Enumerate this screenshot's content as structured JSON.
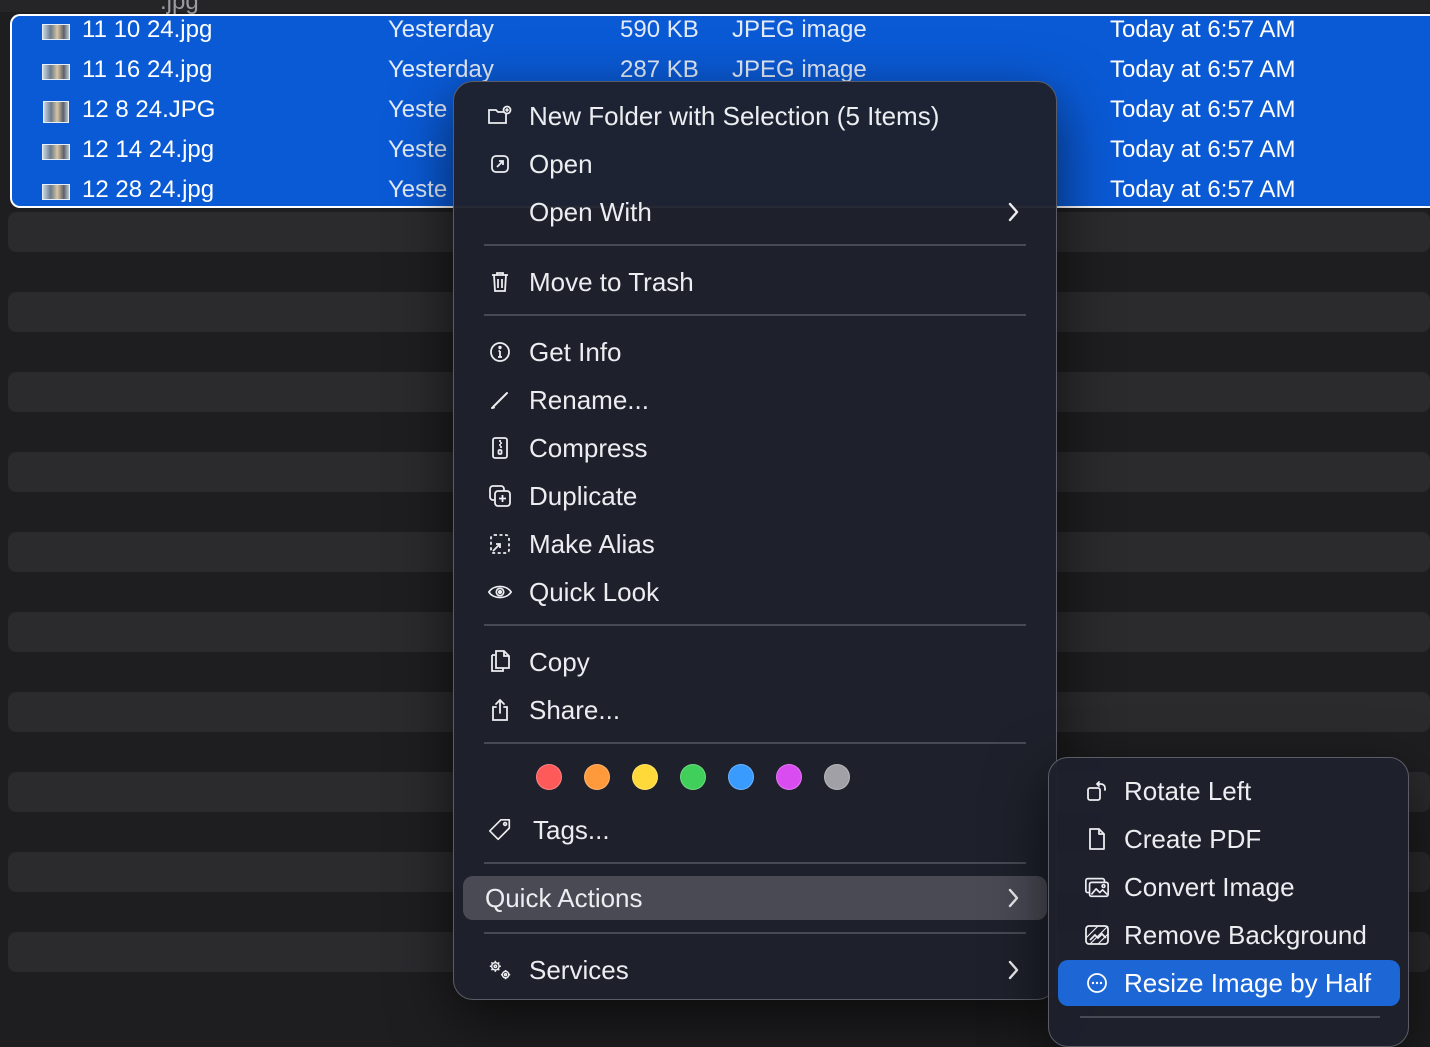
{
  "top_fragment": ".jpg",
  "files": [
    {
      "name": "11 10 24.jpg",
      "date_modified": "Yesterday",
      "size": "590 KB",
      "kind": "JPEG image",
      "date_added": "Today at 6:57 AM"
    },
    {
      "name": "11 16 24.jpg",
      "date_modified": "Yesterday",
      "size": "287 KB",
      "kind": "JPEG image",
      "date_added": "Today at 6:57 AM"
    },
    {
      "name": "12 8 24.JPG",
      "date_modified": "Yeste",
      "size": "",
      "kind": "",
      "date_added": "Today at 6:57 AM"
    },
    {
      "name": "12 14 24.jpg",
      "date_modified": "Yeste",
      "size": "",
      "kind": "",
      "date_added": "Today at 6:57 AM"
    },
    {
      "name": "12 28 24.jpg",
      "date_modified": "Yeste",
      "size": "",
      "kind": "",
      "date_added": "Today at 6:57 AM"
    }
  ],
  "context_menu": {
    "new_folder": "New Folder with Selection (5 Items)",
    "open": "Open",
    "open_with": "Open With",
    "move_to_trash": "Move to Trash",
    "get_info": "Get Info",
    "rename": "Rename...",
    "compress": "Compress",
    "duplicate": "Duplicate",
    "make_alias": "Make Alias",
    "quick_look": "Quick Look",
    "copy": "Copy",
    "share": "Share...",
    "tag_colors": [
      "#ff5a5a",
      "#ff9a3c",
      "#ffd93a",
      "#3fcf5a",
      "#3a9bff",
      "#d84cf0",
      "#a0a0a6"
    ],
    "tags": "Tags...",
    "quick_actions": "Quick Actions",
    "services": "Services"
  },
  "quick_actions_submenu": {
    "rotate_left": "Rotate Left",
    "create_pdf": "Create PDF",
    "convert_image": "Convert Image",
    "remove_background": "Remove Background",
    "resize_image_by_half": "Resize Image by Half"
  },
  "colors": {
    "selection_blue": "#0a5ad6",
    "submenu_highlight": "#1c66d6",
    "menu_highlight": "#4a4a55"
  }
}
